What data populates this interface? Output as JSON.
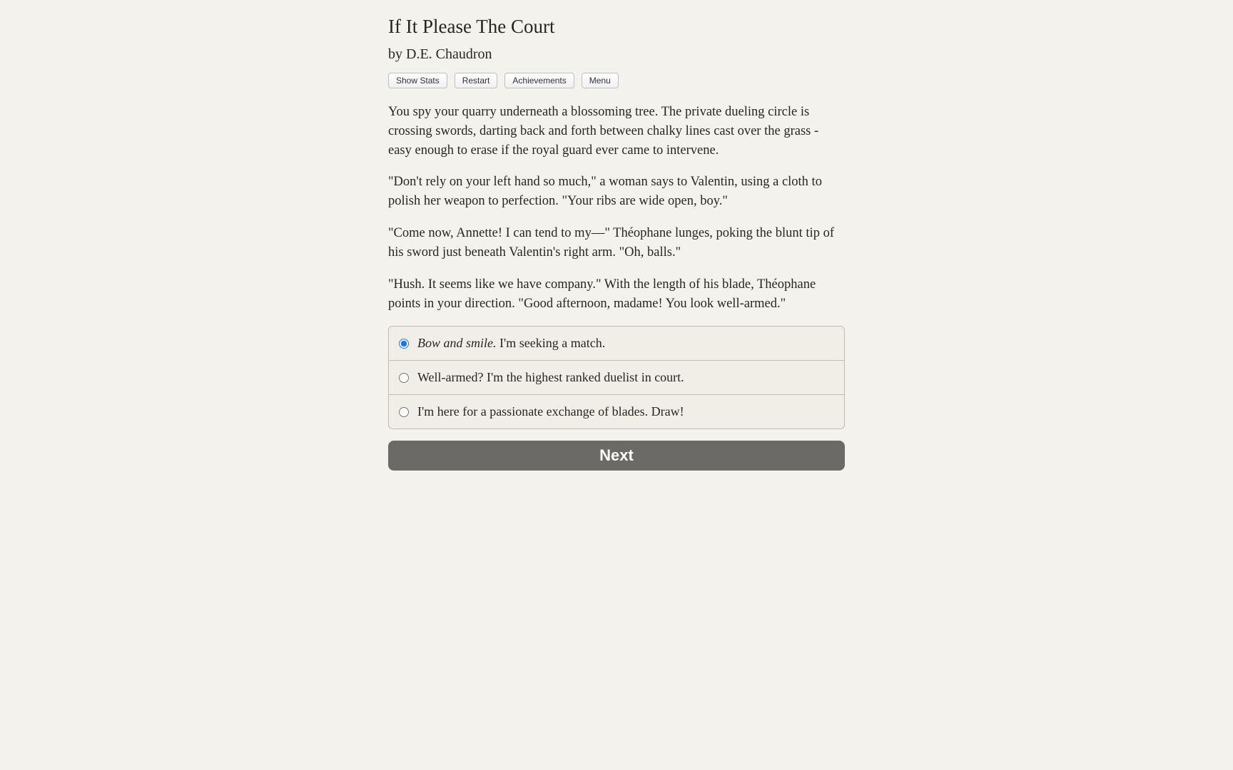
{
  "title": "If It Please The Court",
  "author": "by D.E. Chaudron",
  "toolbar": {
    "show_stats": "Show Stats",
    "restart": "Restart",
    "achievements": "Achievements",
    "menu": "Menu"
  },
  "story": {
    "p1": "You spy your quarry underneath a blossoming tree. The private dueling circle is crossing swords, darting back and forth between chalky lines cast over the grass - easy enough to erase if the royal guard ever came to intervene.",
    "p2": "\"Don't rely on your left hand so much,\" a woman says to Valentin, using a cloth to polish her weapon to perfection. \"Your ribs are wide open, boy.\"",
    "p3": "\"Come now, Annette! I can tend to my—\" Théophane lunges, poking the blunt tip of his sword just beneath Valentin's right arm. \"Oh, balls.\"",
    "p4": "\"Hush. It seems like we have company.\" With the length of his blade, Théophane points in your direction. \"Good afternoon, madame! You look well-armed.\""
  },
  "choices": [
    {
      "italic": "Bow and smile.",
      "text": " I'm seeking a match.",
      "selected": true
    },
    {
      "italic": "",
      "text": "Well-armed? I'm the highest ranked duelist in court.",
      "selected": false
    },
    {
      "italic": "",
      "text": "I'm here for a passionate exchange of blades. Draw!",
      "selected": false
    }
  ],
  "next_label": "Next"
}
